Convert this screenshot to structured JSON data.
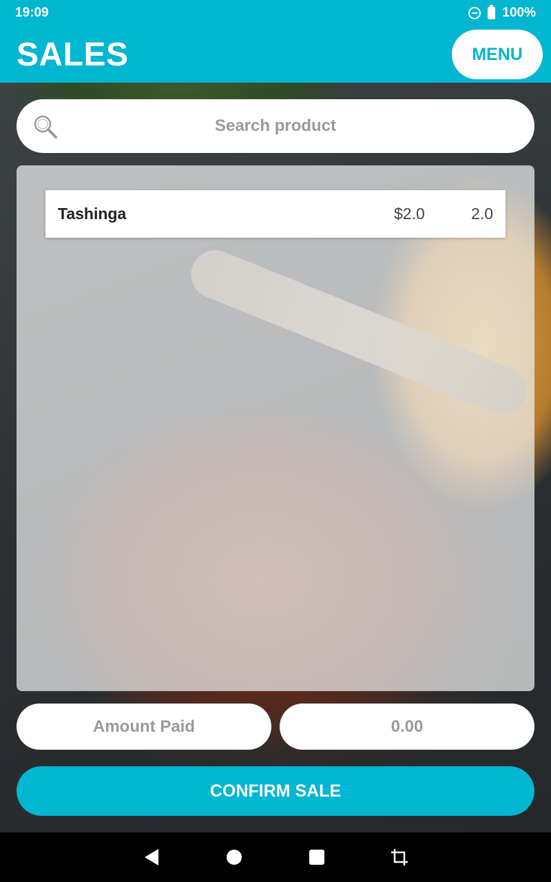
{
  "status_bar": {
    "time": "19:09",
    "battery": "100%"
  },
  "app_bar": {
    "title": "SALES",
    "menu_label": "MENU"
  },
  "search": {
    "placeholder": "Search product"
  },
  "products": [
    {
      "name": "Tashinga",
      "price": "$2.0",
      "quantity": "2.0"
    }
  ],
  "payment": {
    "amount_label": "Amount Paid",
    "amount_placeholder": "0.00"
  },
  "confirm_label": "CONFIRM SALE",
  "colors": {
    "accent": "#00b6d1"
  }
}
